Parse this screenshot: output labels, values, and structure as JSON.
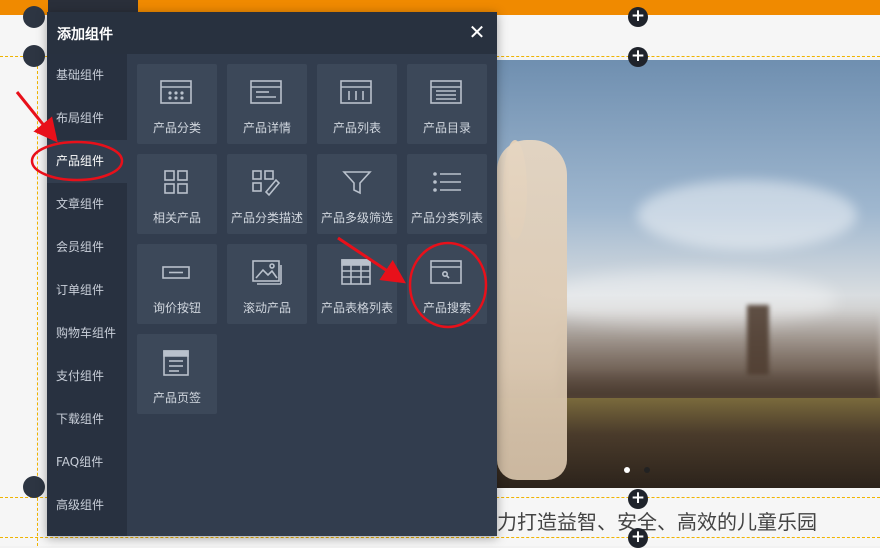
{
  "panel": {
    "title": "添加组件",
    "close_label": "✕"
  },
  "sidebar": {
    "items": [
      {
        "label": "基础组件"
      },
      {
        "label": "布局组件"
      },
      {
        "label": "产品组件",
        "active": true
      },
      {
        "label": "文章组件"
      },
      {
        "label": "会员组件"
      },
      {
        "label": "订单组件"
      },
      {
        "label": "购物车组件"
      },
      {
        "label": "支付组件"
      },
      {
        "label": "下载组件"
      },
      {
        "label": "FAQ组件"
      },
      {
        "label": "高级组件"
      }
    ]
  },
  "components": [
    {
      "label": "产品分类",
      "icon": "product-category-icon"
    },
    {
      "label": "产品详情",
      "icon": "product-detail-icon"
    },
    {
      "label": "产品列表",
      "icon": "product-list-icon"
    },
    {
      "label": "产品目录",
      "icon": "product-catalog-icon"
    },
    {
      "label": "相关产品",
      "icon": "related-products-icon"
    },
    {
      "label": "产品分类描述",
      "icon": "category-description-icon"
    },
    {
      "label": "产品多级筛选",
      "icon": "filter-icon"
    },
    {
      "label": "产品分类列表",
      "icon": "category-list-icon"
    },
    {
      "label": "询价按钮",
      "icon": "inquiry-button-icon"
    },
    {
      "label": "滚动产品",
      "icon": "scrolling-products-icon"
    },
    {
      "label": "产品表格列表",
      "icon": "table-list-icon"
    },
    {
      "label": "产品搜索",
      "icon": "product-search-icon"
    },
    {
      "label": "产品页签",
      "icon": "product-tabs-icon"
    }
  ],
  "page": {
    "tagline": "力打造益智、安全、高效的儿童乐园",
    "add_button": "+"
  },
  "colors": {
    "accent": "#f08a00",
    "panel": "#323d4e",
    "sidebar": "#283140",
    "tile": "#3c4859",
    "annotation": "#e8101a"
  }
}
